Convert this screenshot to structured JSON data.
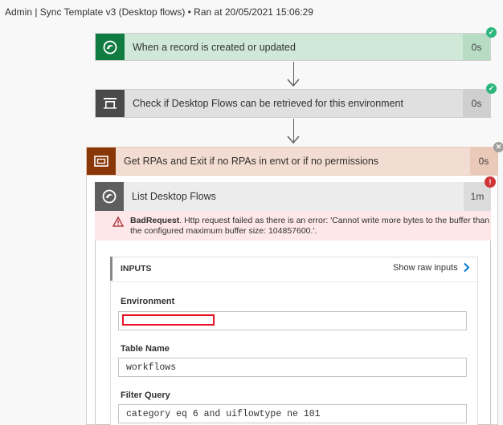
{
  "header": {
    "run_title": "Admin | Sync Template v3 (Desktop flows) • Ran at 20/05/2021 15:06:29"
  },
  "steps": [
    {
      "title": "When a record is created or updated",
      "duration": "0s",
      "status": "success",
      "icon": "dataverse-icon"
    },
    {
      "title": "Check if Desktop Flows can be retrieved for this environment",
      "duration": "0s",
      "status": "success",
      "icon": "scope-icon"
    },
    {
      "title": "Get RPAs and Exit if no RPAs in envt or if no permissions",
      "duration": "0s",
      "status": "skipped",
      "icon": "scope-icon"
    }
  ],
  "inner_action": {
    "title": "List Desktop Flows",
    "duration": "1m",
    "status": "failed",
    "icon": "dataverse-icon",
    "error": {
      "code": "BadRequest",
      "message_line1": ". Http request failed as there is an error: 'Cannot write more bytes to the buffer than",
      "message_line2": "the configured maximum buffer size: 104857600.'."
    },
    "inputs": {
      "heading": "INPUTS",
      "show_raw_label": "Show raw inputs",
      "fields": [
        {
          "label": "Environment",
          "value": ""
        },
        {
          "label": "Table Name",
          "value": "workflows"
        },
        {
          "label": "Filter Query",
          "value": "category eq 6 and uiflowtype ne 101"
        }
      ]
    }
  },
  "colors": {
    "trigger_accent": "#107c41",
    "trigger_bg": "#cfe8d8",
    "check_accent": "#4a4a4a",
    "check_bg": "#e0e0e0",
    "scope_accent": "#8a3707",
    "scope_bg": "#f3dcd1",
    "action_accent": "#5e5e5e",
    "action_bg": "#ececec",
    "success": "#2eb67d",
    "failed": "#d13438",
    "skipped": "#a19f9d",
    "redaction": "#e81123"
  }
}
